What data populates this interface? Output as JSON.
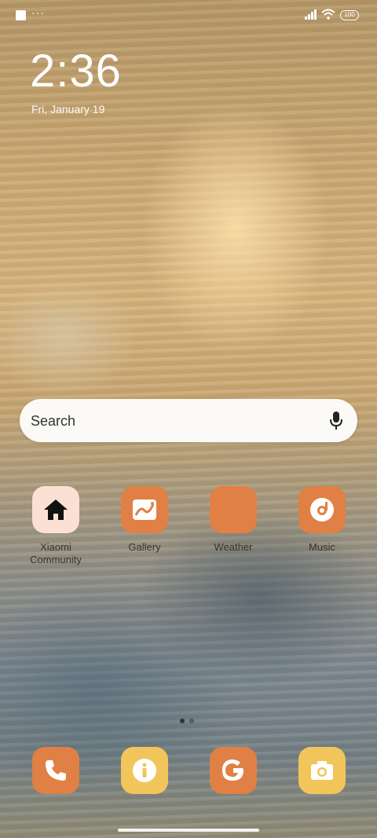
{
  "status_bar": {
    "notification_dots": "···",
    "battery_level": "100",
    "signal_icon": "cellular-signal-icon",
    "wifi_icon": "wifi-icon"
  },
  "lockscreen": {
    "time": "2:36",
    "date": "Fri, January 19"
  },
  "search": {
    "placeholder": "Search",
    "mic_icon": "microphone-icon"
  },
  "apps": [
    {
      "label": "Xiaomi Community",
      "icon": "home-icon",
      "color": "#fbe1d4"
    },
    {
      "label": "Gallery",
      "icon": "gallery-icon",
      "color": "#e08045"
    },
    {
      "label": "Weather",
      "icon": "weather-icon",
      "color": "#e08045"
    },
    {
      "label": "Music",
      "icon": "music-icon",
      "color": "#e08045"
    }
  ],
  "page_indicator": {
    "pages": 2,
    "active": 1
  },
  "dock": [
    {
      "icon": "phone-icon",
      "color": "#e08045"
    },
    {
      "icon": "info-icon",
      "color": "#f2c55a"
    },
    {
      "icon": "google-icon",
      "color": "#e08045"
    },
    {
      "icon": "camera-icon",
      "color": "#f2c55a"
    }
  ],
  "colors": {
    "accent_orange": "#e08045",
    "accent_yellow": "#f2c55a",
    "pale_peach": "#fbe1d4"
  }
}
